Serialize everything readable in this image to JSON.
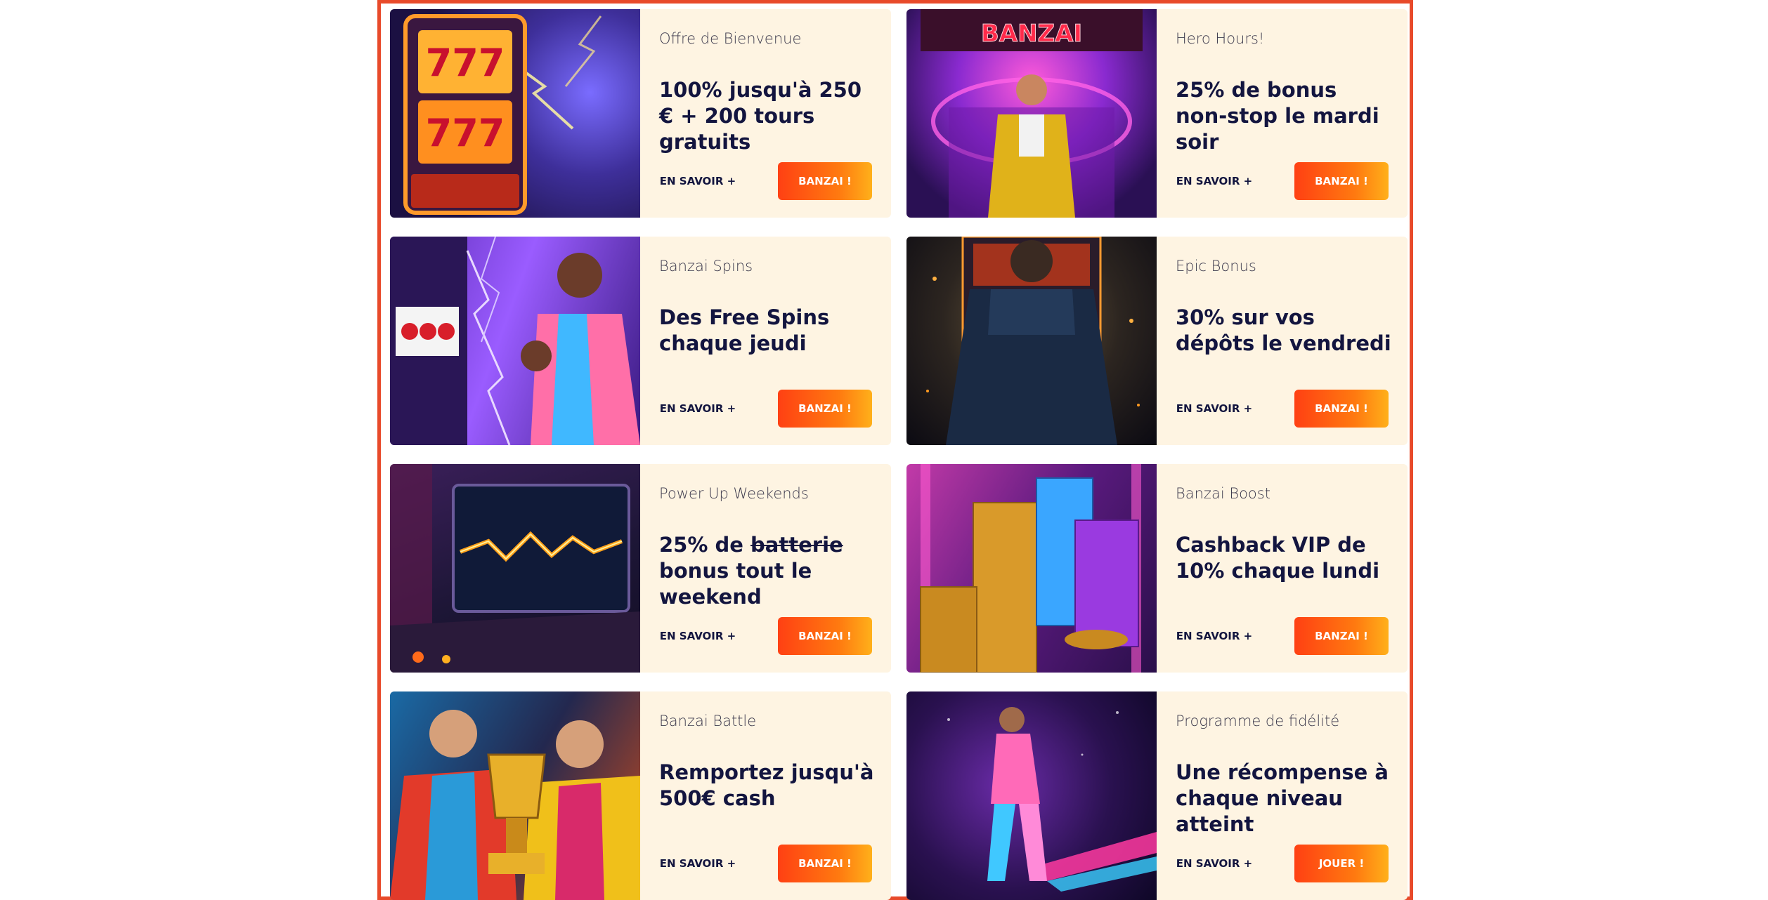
{
  "promos": [
    {
      "label": "Offre de Bienvenue",
      "title": "100% jusqu'à 250 € + 200 tours gratuits",
      "more_label": "EN SAVOIR +",
      "cta_label": "BANZAI !",
      "image_icon": "slot-machine-lightning-image"
    },
    {
      "label": "Hero Hours!",
      "title": "25% de bonus non-stop le mardi soir",
      "more_label": "EN SAVOIR +",
      "cta_label": "BANZAI !",
      "image_icon": "banzai-casino-hero-image",
      "image_sign": "BANZAI"
    },
    {
      "label": "Banzai Spins",
      "title": "Des Free Spins chaque jeudi",
      "more_label": "EN SAVOIR +",
      "cta_label": "BANZAI !",
      "image_icon": "player-celebrating-slots-image"
    },
    {
      "label": "Epic Bonus",
      "title": "30% sur vos dépôts le vendredi",
      "more_label": "EN SAVOIR +",
      "cta_label": "BANZAI !",
      "image_icon": "player-at-slot-machine-image"
    },
    {
      "label": "Power Up Weekends",
      "title_prefix": "25% de ",
      "title_struck": "batterie",
      "title_suffix": " bonus tout le weekend",
      "more_label": "EN SAVOIR +",
      "cta_label": "BANZAI !",
      "image_icon": "power-battery-screen-image"
    },
    {
      "label": "Banzai Boost",
      "title": "Cashback VIP de 10% chaque lundi",
      "more_label": "EN SAVOIR +",
      "cta_label": "BANZAI !",
      "image_icon": "coin-and-chip-stacks-image"
    },
    {
      "label": "Banzai Battle",
      "title": "Remportez jusqu'à 500€ cash",
      "more_label": "EN SAVOIR +",
      "cta_label": "BANZAI !",
      "image_icon": "trophy-winners-image"
    },
    {
      "label": "Programme de fidélité",
      "title": "Une récompense à chaque niveau atteint",
      "more_label": "EN SAVOIR +",
      "cta_label": "JOUER !",
      "image_icon": "walking-hero-neon-image"
    }
  ],
  "colors": {
    "frame_border": "#e84a2a",
    "card_background": "#fef4e2",
    "title_text": "#13153f",
    "cta_gradient_start": "#ff4013",
    "cta_gradient_end": "#ffb01a"
  }
}
